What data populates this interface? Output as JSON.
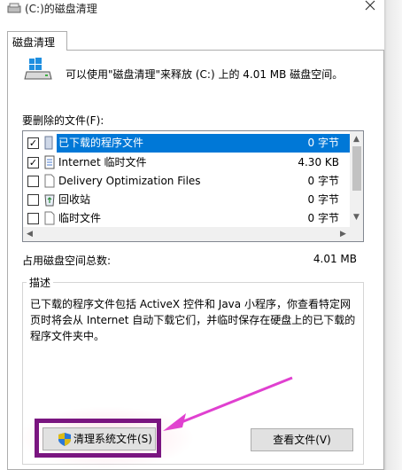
{
  "window": {
    "title": "(C:)的磁盘清理"
  },
  "tab": {
    "label": "磁盘清理"
  },
  "summary": {
    "text": "可以使用\"磁盘清理\"来释放  (C:) 上的 4.01 MB 磁盘空间。"
  },
  "files": {
    "label": "要删除的文件(F):",
    "rows": [
      {
        "name": "已下载的程序文件",
        "size": "0 字节",
        "checked": "✓",
        "icon": "folder-icon",
        "selected": true
      },
      {
        "name": "Internet 临时文件",
        "size": "4.30 KB",
        "checked": "✓",
        "icon": "document-icon",
        "selected": false
      },
      {
        "name": "Delivery Optimization Files",
        "size": "0 字节",
        "checked": "",
        "icon": "file-icon",
        "selected": false
      },
      {
        "name": "回收站",
        "size": "0 字节",
        "checked": "",
        "icon": "recycle-bin-icon",
        "selected": false
      },
      {
        "name": "临时文件",
        "size": "0 字节",
        "checked": "",
        "icon": "file-icon",
        "selected": false
      }
    ]
  },
  "total": {
    "label": "占用磁盘空间总数:",
    "value": "4.01 MB"
  },
  "description": {
    "title": "描述",
    "text": "已下载的程序文件包括 ActiveX 控件和 Java 小程序，你查看特定网页时将会从 Internet 自动下载它们，并临时保存在硬盘上的已下载的程序文件夹中。"
  },
  "buttons": {
    "cleanup_system": "清理系统文件(S)",
    "view_files": "查看文件(V)"
  },
  "colors": {
    "selection": "#0078d7",
    "highlight": "#7a1580",
    "arrow": "#e040d0"
  }
}
